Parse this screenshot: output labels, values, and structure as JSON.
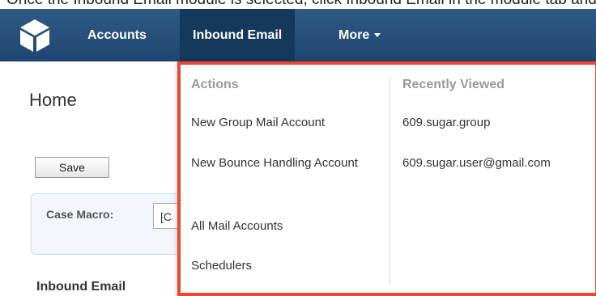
{
  "caption": "Once the Inbound Email module is selected, click Inbound Email in the module tab and select the appropriate option",
  "navbar": {
    "logo_icon": "sugarcube-logo-icon",
    "items": [
      {
        "label": "Accounts"
      },
      {
        "label": "Inbound Email"
      },
      {
        "label": "More"
      }
    ],
    "background": "#1f4670",
    "active_background": "#15385d"
  },
  "page": {
    "title": "Home",
    "save_label": "Save",
    "case_macro_label": "Case Macro:",
    "case_macro_value": "[C",
    "section_heading": "Inbound Email"
  },
  "dropdown": {
    "border_color": "#e94a2f",
    "actions_heading": "Actions",
    "actions": [
      {
        "label": "New Group Mail Account"
      },
      {
        "label": "New Bounce Handling Account"
      },
      {
        "label": "All Mail Accounts"
      },
      {
        "label": "Schedulers"
      }
    ],
    "recent_heading": "Recently Viewed",
    "recent": [
      {
        "label": "609.sugar.group"
      },
      {
        "label": "609.sugar.user@gmail.com"
      }
    ]
  }
}
